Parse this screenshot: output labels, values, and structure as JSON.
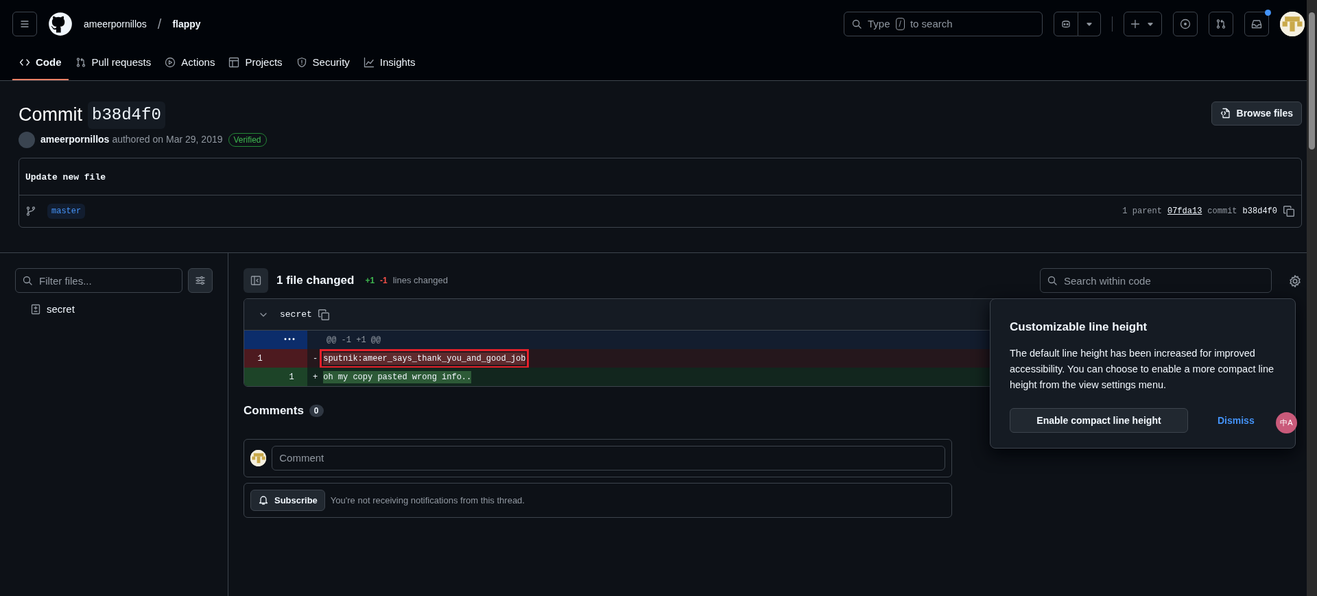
{
  "header": {
    "owner": "ameerpornillos",
    "separator": "/",
    "repo": "flappy",
    "search": {
      "before": "Type",
      "key": "/",
      "after": "to search"
    },
    "notification_unread": true
  },
  "tabs": [
    {
      "label": "Code",
      "selected": true
    },
    {
      "label": "Pull requests",
      "selected": false
    },
    {
      "label": "Actions",
      "selected": false
    },
    {
      "label": "Projects",
      "selected": false
    },
    {
      "label": "Security",
      "selected": false
    },
    {
      "label": "Insights",
      "selected": false
    }
  ],
  "commit": {
    "title": "Commit",
    "sha": "b38d4f0",
    "author": "ameerpornillos",
    "authored": "authored on Mar 29, 2019",
    "badge": "Verified",
    "browse_button": "Browse files",
    "message": "Update new file",
    "branch": "master",
    "parents_label": "1 parent",
    "parent_sha": "07fda13",
    "commit_label": "commit",
    "commit_sha": "b38d4f0"
  },
  "sidebar": {
    "filter": {
      "placeholder": "Filter files..."
    },
    "files": [
      {
        "name": "secret"
      }
    ]
  },
  "diff": {
    "summary": "1 file changed",
    "additions": "+1",
    "deletions": "-1",
    "lines_label": "lines changed",
    "search": {
      "placeholder": "Search within code"
    },
    "file": {
      "name": "secret",
      "expanded": true,
      "lines": [
        {
          "kind": "hunk",
          "expander": "•••",
          "text": "@@ -1 +1 @@",
          "annotated": false
        },
        {
          "kind": "del",
          "old": "1",
          "marker": "-",
          "text": "sputnik:ameer_says_thank_you_and_good_job",
          "annotated": true
        },
        {
          "kind": "add",
          "new": "1",
          "marker": "+",
          "text": "oh my copy pasted wrong info..",
          "annotated": false
        }
      ]
    }
  },
  "comments": {
    "title": "Comments",
    "count": "0",
    "placeholder": "Comment",
    "subscribe_button": "Subscribe",
    "subscribe_note": "You're not receiving notifications from this thread."
  },
  "popover": {
    "title": "Customizable line height",
    "body": "The default line height has been increased for improved accessibility. You can choose to enable a more compact line height from the view settings menu.",
    "primary_button": "Enable compact line height",
    "dismiss": "Dismiss"
  },
  "translate_button": {
    "label": "中A"
  }
}
